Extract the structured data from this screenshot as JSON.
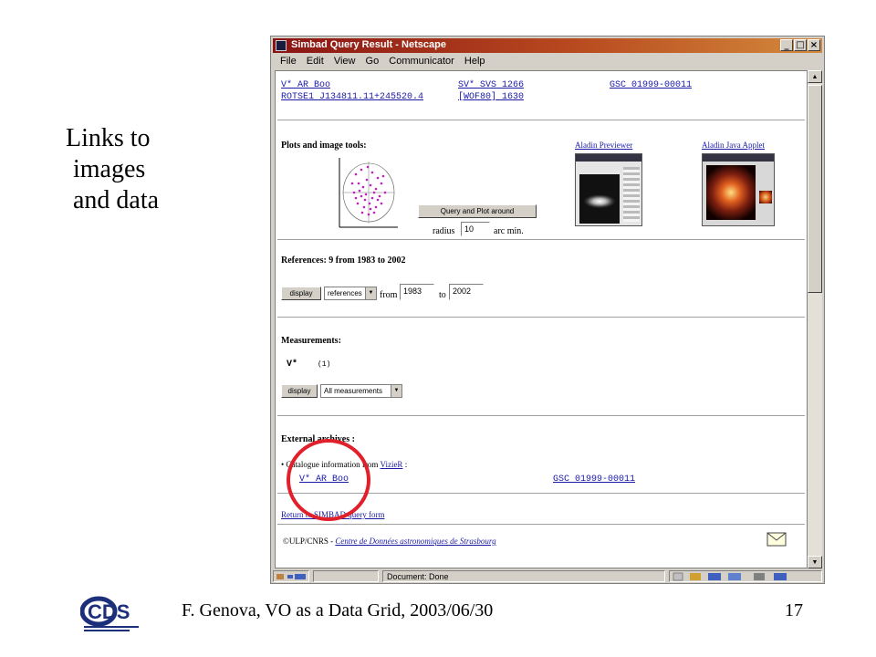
{
  "slide": {
    "side_text_lines": [
      "Links to",
      "images",
      "and data"
    ],
    "footer_text": "F. Genova, VO as a Data Grid, 2003/06/30",
    "page_number": "17",
    "logo_text": "CDS"
  },
  "browser": {
    "title": "Simbad Query Result - Netscape",
    "menu": [
      {
        "label": "File"
      },
      {
        "label": "Edit"
      },
      {
        "label": "View"
      },
      {
        "label": "Go"
      },
      {
        "label": "Communicator"
      },
      {
        "label": "Help"
      }
    ],
    "status": "Document: Done"
  },
  "page": {
    "identifiers": {
      "row1": [
        "V* AR Boo",
        "SV* SVS 1266",
        "GSC 01999-00011"
      ],
      "row2": [
        "ROTSE1 J134811.11+245520.4",
        "[WOF80] 1630"
      ]
    },
    "plots": {
      "heading": "Plots and image tools:",
      "aladin_previewer": "Aladin Previewer",
      "aladin_applet": "Aladin Java Applet",
      "query_button": "Query and Plot around",
      "radius_label": "radius",
      "radius_value": "10",
      "radius_unit": "arc min."
    },
    "references": {
      "heading": "References: 9 from 1983 to 2002",
      "display_button": "display",
      "select_value": "references",
      "from_label": "from",
      "from_value": "1983",
      "to_label": "to",
      "to_value": "2002"
    },
    "measurements": {
      "heading": "Measurements:",
      "item_label": "V*",
      "item_count": "(1)",
      "display_button": "display",
      "select_value": "All measurements"
    },
    "external": {
      "heading": "External archives :",
      "bullet_text": "Catalogue information from",
      "vizier_link": "VizieR",
      "colon": ":",
      "links": [
        "V* AR Boo",
        "GSC 01999-00011"
      ]
    },
    "return_link": "Return to SIMBAD query form",
    "copyright_prefix": "©ULP/CNRS -",
    "copyright_link": "Centre de Données astronomiques de Strasbourg"
  },
  "colors": {
    "annotation_circle": "#e0202a",
    "link": "#1a1aa6",
    "title_bar": "#8a1414"
  }
}
